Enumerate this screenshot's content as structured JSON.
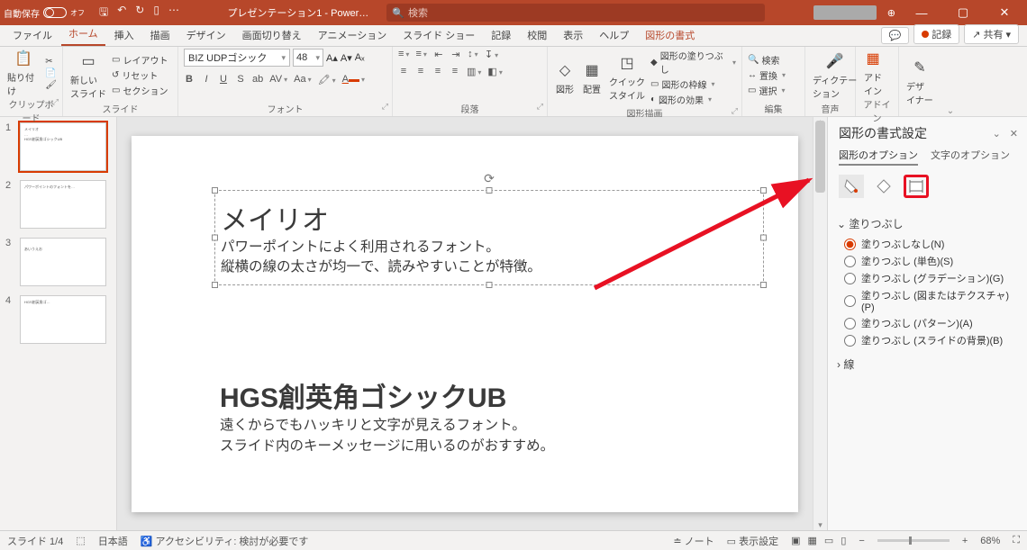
{
  "titlebar": {
    "autosave": "自動保存",
    "autosave_state": "オフ",
    "title": "プレゼンテーション1 - Power…",
    "search_placeholder": "検索"
  },
  "tabs": {
    "file": "ファイル",
    "home": "ホーム",
    "insert": "挿入",
    "draw": "描画",
    "design": "デザイン",
    "transitions": "画面切り替え",
    "animations": "アニメーション",
    "slideshow": "スライド ショー",
    "record": "記録",
    "review": "校閲",
    "view": "表示",
    "help": "ヘルプ",
    "shapeformat": "図形の書式",
    "recbtn": "記録",
    "sharebtn": "共有"
  },
  "ribbon": {
    "clipboard": {
      "paste": "貼り付け",
      "label": "クリップボード"
    },
    "slides": {
      "new": "新しい\nスライド",
      "layout": "レイアウト",
      "reset": "リセット",
      "section": "セクション",
      "label": "スライド"
    },
    "font": {
      "name": "BIZ UDPゴシック",
      "size": "48",
      "label": "フォント"
    },
    "paragraph": {
      "label": "段落"
    },
    "drawing": {
      "shapes": "図形",
      "arrange": "配置",
      "quick": "クイック\nスタイル",
      "fill": "図形の塗りつぶし",
      "outline": "図形の枠線",
      "effects": "図形の効果",
      "label": "図形描画"
    },
    "editing": {
      "find": "検索",
      "replace": "置換",
      "select": "選択",
      "label": "編集"
    },
    "voice": {
      "dictate": "ディクテー\nション",
      "label": "音声"
    },
    "addin": {
      "addin": "アド\nイン",
      "label": "アドイン"
    },
    "designer": {
      "designer": "デザ\nイナー"
    }
  },
  "slide": {
    "h1": "メイリオ",
    "p1a": "パワーポイントによく利用されるフォント。",
    "p1b": "縦横の線の太さが均一で、読みやすいことが特徴。",
    "h2": "HGS創英角ゴシックUB",
    "p2a": "遠くからでもハッキリと文字が見えるフォント。",
    "p2b": "スライド内のキーメッセージに用いるのがおすすめ。"
  },
  "thumbs": [
    {
      "n": "1"
    },
    {
      "n": "2"
    },
    {
      "n": "3"
    },
    {
      "n": "4"
    }
  ],
  "pane": {
    "title": "図形の書式設定",
    "tab_shape": "図形のオプション",
    "tab_text": "文字のオプション",
    "sec_fill": "塗りつぶし",
    "fill_none": "塗りつぶしなし(N)",
    "fill_solid": "塗りつぶし (単色)(S)",
    "fill_grad": "塗りつぶし (グラデーション)(G)",
    "fill_pic": "塗りつぶし (図またはテクスチャ)(P)",
    "fill_pat": "塗りつぶし (パターン)(A)",
    "fill_bg": "塗りつぶし (スライドの背景)(B)",
    "sec_line": "線"
  },
  "status": {
    "slide": "スライド 1/4",
    "lang": "日本語",
    "acc": "アクセシビリティ: 検討が必要です",
    "notes": "ノート",
    "display": "表示設定",
    "zoom": "68%"
  }
}
